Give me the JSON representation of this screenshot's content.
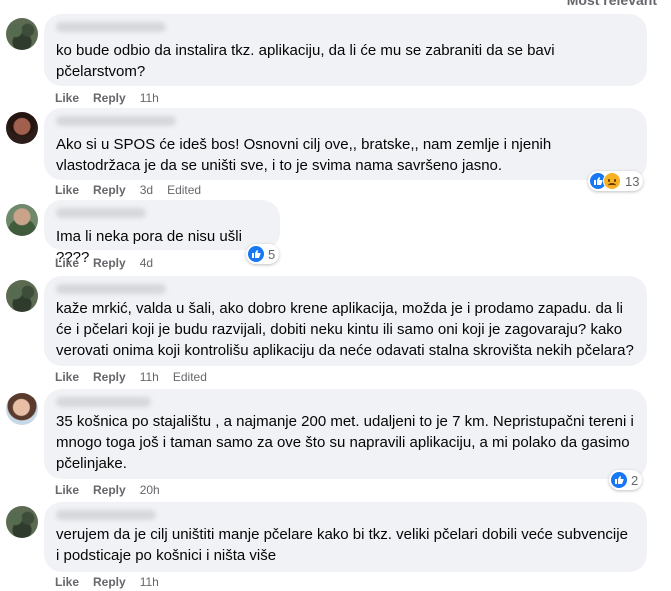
{
  "sort_label": "Most relevant",
  "comments": [
    {
      "text": "ko bude odbio da instalira tkz. aplikaciju, da li će mu se zabraniti da se bavi pčelarstvom?",
      "like": "Like",
      "reply": "Reply",
      "time": "11h",
      "edited": ""
    },
    {
      "text": "Ako si u SPOS će ideš bos! Osnovni cilj ove,, bratske,, nam zemlje i njenih vlastodržaca je da se uništi sve, i to je svima nama savršeno jasno.",
      "like": "Like",
      "reply": "Reply",
      "time": "3d",
      "edited": "Edited",
      "reaction_count": "13"
    },
    {
      "text": "Ima li neka pora de nisu ušli ????",
      "like": "Like",
      "reply": "Reply",
      "time": "4d",
      "edited": "",
      "reaction_count": "5"
    },
    {
      "text": "kaže mrkić, valda u šali, ako dobro krene aplikacija, možda je i prodamo zapadu. da li će i pčelari koji je budu razvijali, dobiti neku kintu ili samo oni koji je zagovaraju? kako verovati onima koji kontrolišu aplikaciju da neće odavati stalna skrovišta nekih pčelara?",
      "like": "Like",
      "reply": "Reply",
      "time": "11h",
      "edited": "Edited"
    },
    {
      "text": "35 košnica po stajalištu , a najmanje 200 met. udaljeni to je 7 km. Nepristupačni tereni i mnogo toga još i taman samo za ove što su napravili aplikaciju, a mi polako da gasimo pčelinjake.",
      "like": "Like",
      "reply": "Reply",
      "time": "20h",
      "edited": "",
      "reaction_count": "2"
    },
    {
      "text": "verujem da je cilj uništiti manje pčelare kako bi tkz. veliki pčelari dobili veće subvencije i podsticaje po košnici i ništa više",
      "like": "Like",
      "reply": "Reply",
      "time": "11h",
      "edited": ""
    }
  ]
}
